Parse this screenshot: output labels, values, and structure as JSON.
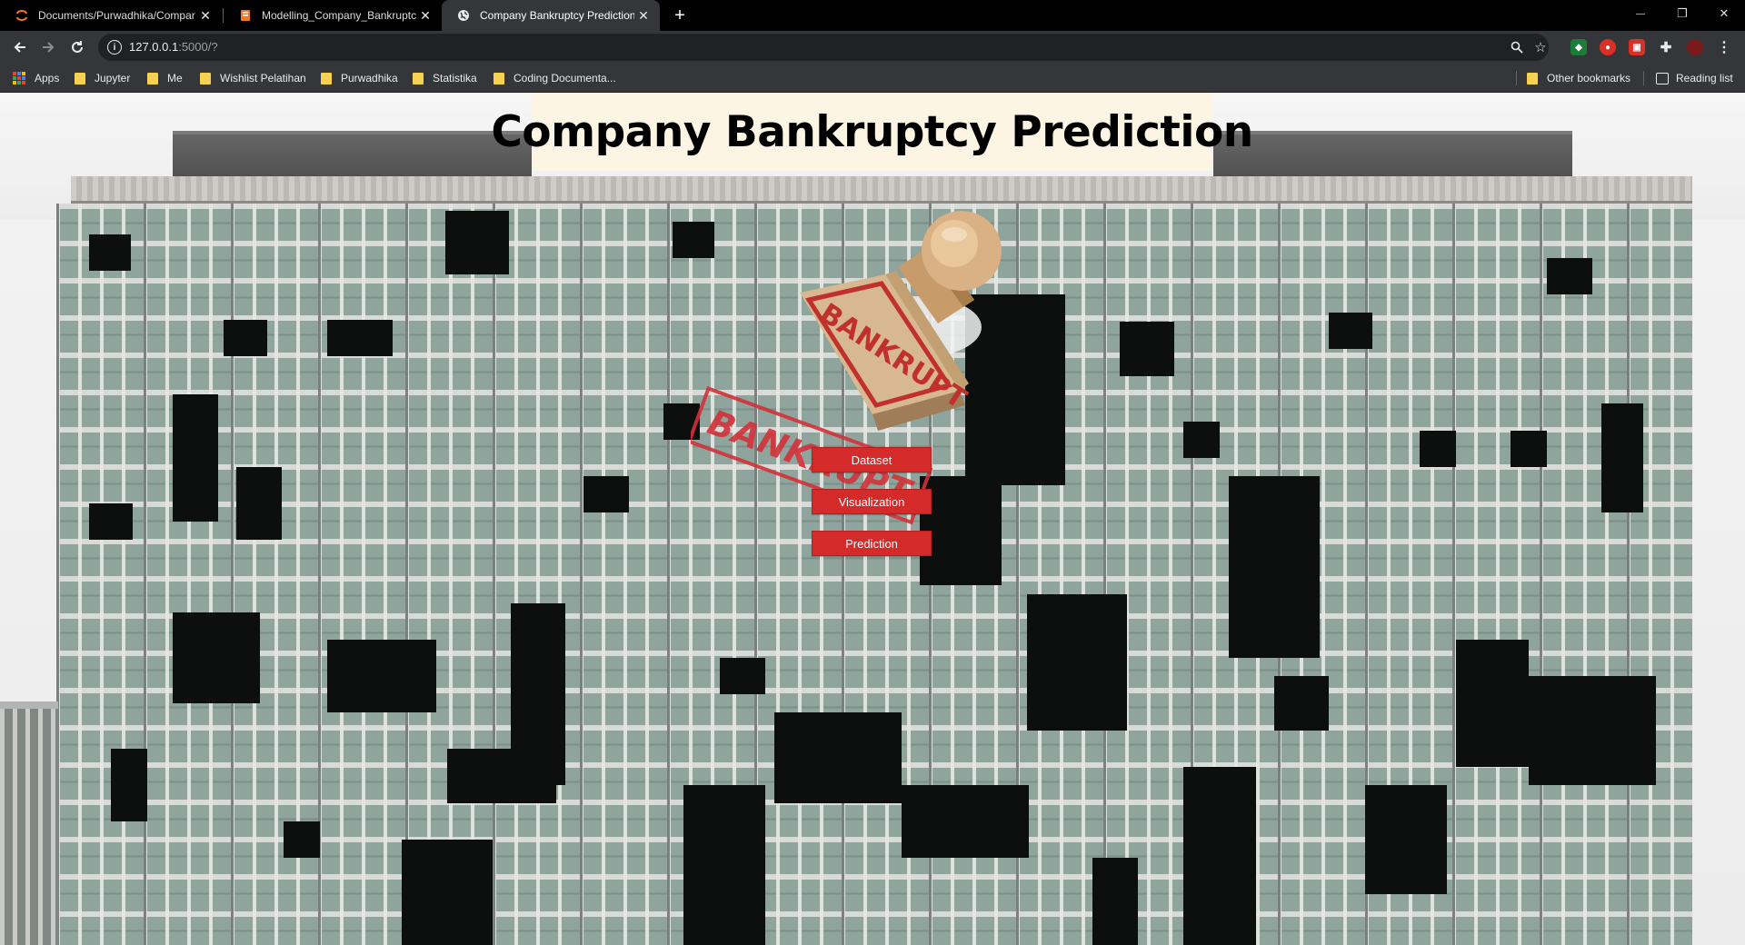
{
  "browser": {
    "tabs": [
      {
        "title": "Documents/Purwadhika/Compar",
        "icon": "jupyter-icon",
        "active": false
      },
      {
        "title": "Modelling_Company_Bankruptcy",
        "icon": "notebook-icon",
        "active": false
      },
      {
        "title": "Company Bankruptcy Prediction",
        "icon": "globe-icon",
        "active": true
      }
    ],
    "new_tab_symbol": "+",
    "window_controls": {
      "minimize": "—",
      "restore": "❐",
      "close": "✕"
    },
    "address": {
      "host": "127.0.0.1",
      "rest": ":5000/?"
    },
    "bookmarks": [
      "Apps",
      "Jupyter",
      "Me",
      "Wishlist Pelatihan",
      "Purwadhika",
      "Statistika",
      "Coding Documenta..."
    ],
    "other_bookmarks": "Other bookmarks",
    "reading_list": "Reading list"
  },
  "page": {
    "title": "Company Bankruptcy Prediction",
    "stamp_text": "BANKRUPT",
    "buttons": {
      "dataset": "Dataset",
      "visualization": "Visualization",
      "prediction": "Prediction"
    }
  },
  "colors": {
    "accent_red": "#d42a29",
    "title_bg": "#fcf5e3"
  }
}
